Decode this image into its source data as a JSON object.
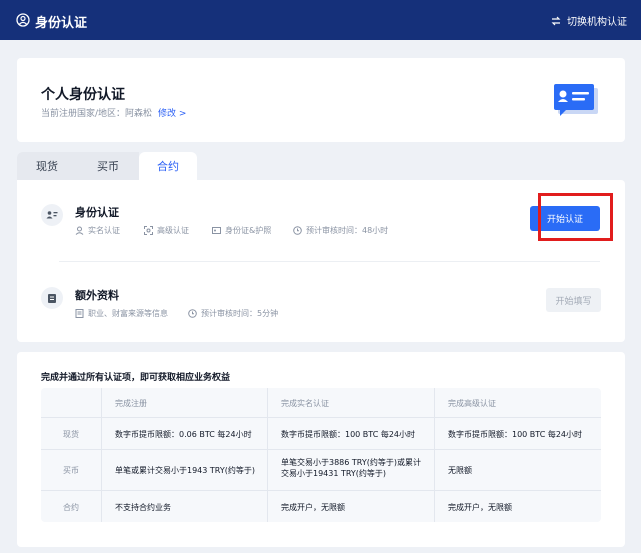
{
  "header": {
    "title": "身份认证",
    "switch_label": "切换机构认证"
  },
  "profile": {
    "heading": "个人身份认证",
    "subtitle": "当前注册国家/地区：阿森松",
    "modify_link": "修改 >"
  },
  "tabs": [
    {
      "label": "现货",
      "active": false
    },
    {
      "label": "买币",
      "active": false
    },
    {
      "label": "合约",
      "active": true
    }
  ],
  "identity": {
    "title": "身份认证",
    "tags": [
      "实名认证",
      "高级认证",
      "身份证&护照"
    ],
    "review_time": "预计审核时间：48小时",
    "button": "开始认证"
  },
  "extra": {
    "title": "额外资料",
    "tag": "职业、财富来源等信息",
    "review_time": "预计审核时间：5分钟",
    "button": "开始填写"
  },
  "benefits": {
    "note": "完成并通过所有认证项，即可获取相应业务权益",
    "columns": [
      "",
      "完成注册",
      "完成实名认证",
      "完成高级认证"
    ],
    "rows": [
      {
        "label": "现货",
        "cells": [
          "数字币提币限额：0.06 BTC 每24小时",
          "数字币提币限额：100 BTC 每24小时",
          "数字币提币限额：100 BTC 每24小时"
        ]
      },
      {
        "label": "买币",
        "cells": [
          "单笔或累计交易小于1943 TRY(约等于)",
          "单笔交易小于3886 TRY(约等于)或累计交易小于19431 TRY(约等于)",
          "无限额"
        ]
      },
      {
        "label": "合约",
        "cells": [
          "不支持合约业务",
          "完成开户，无限额",
          "完成开户，无限额"
        ]
      }
    ]
  },
  "colors": {
    "topbar": "#15307a",
    "accent": "#2a6cf6",
    "highlight": "#e11d1d"
  },
  "icons": [
    "user-circle-icon",
    "switch-icon",
    "id-card-icon",
    "document-icon",
    "user-icon",
    "scan-icon",
    "id-icon",
    "clock-icon"
  ]
}
